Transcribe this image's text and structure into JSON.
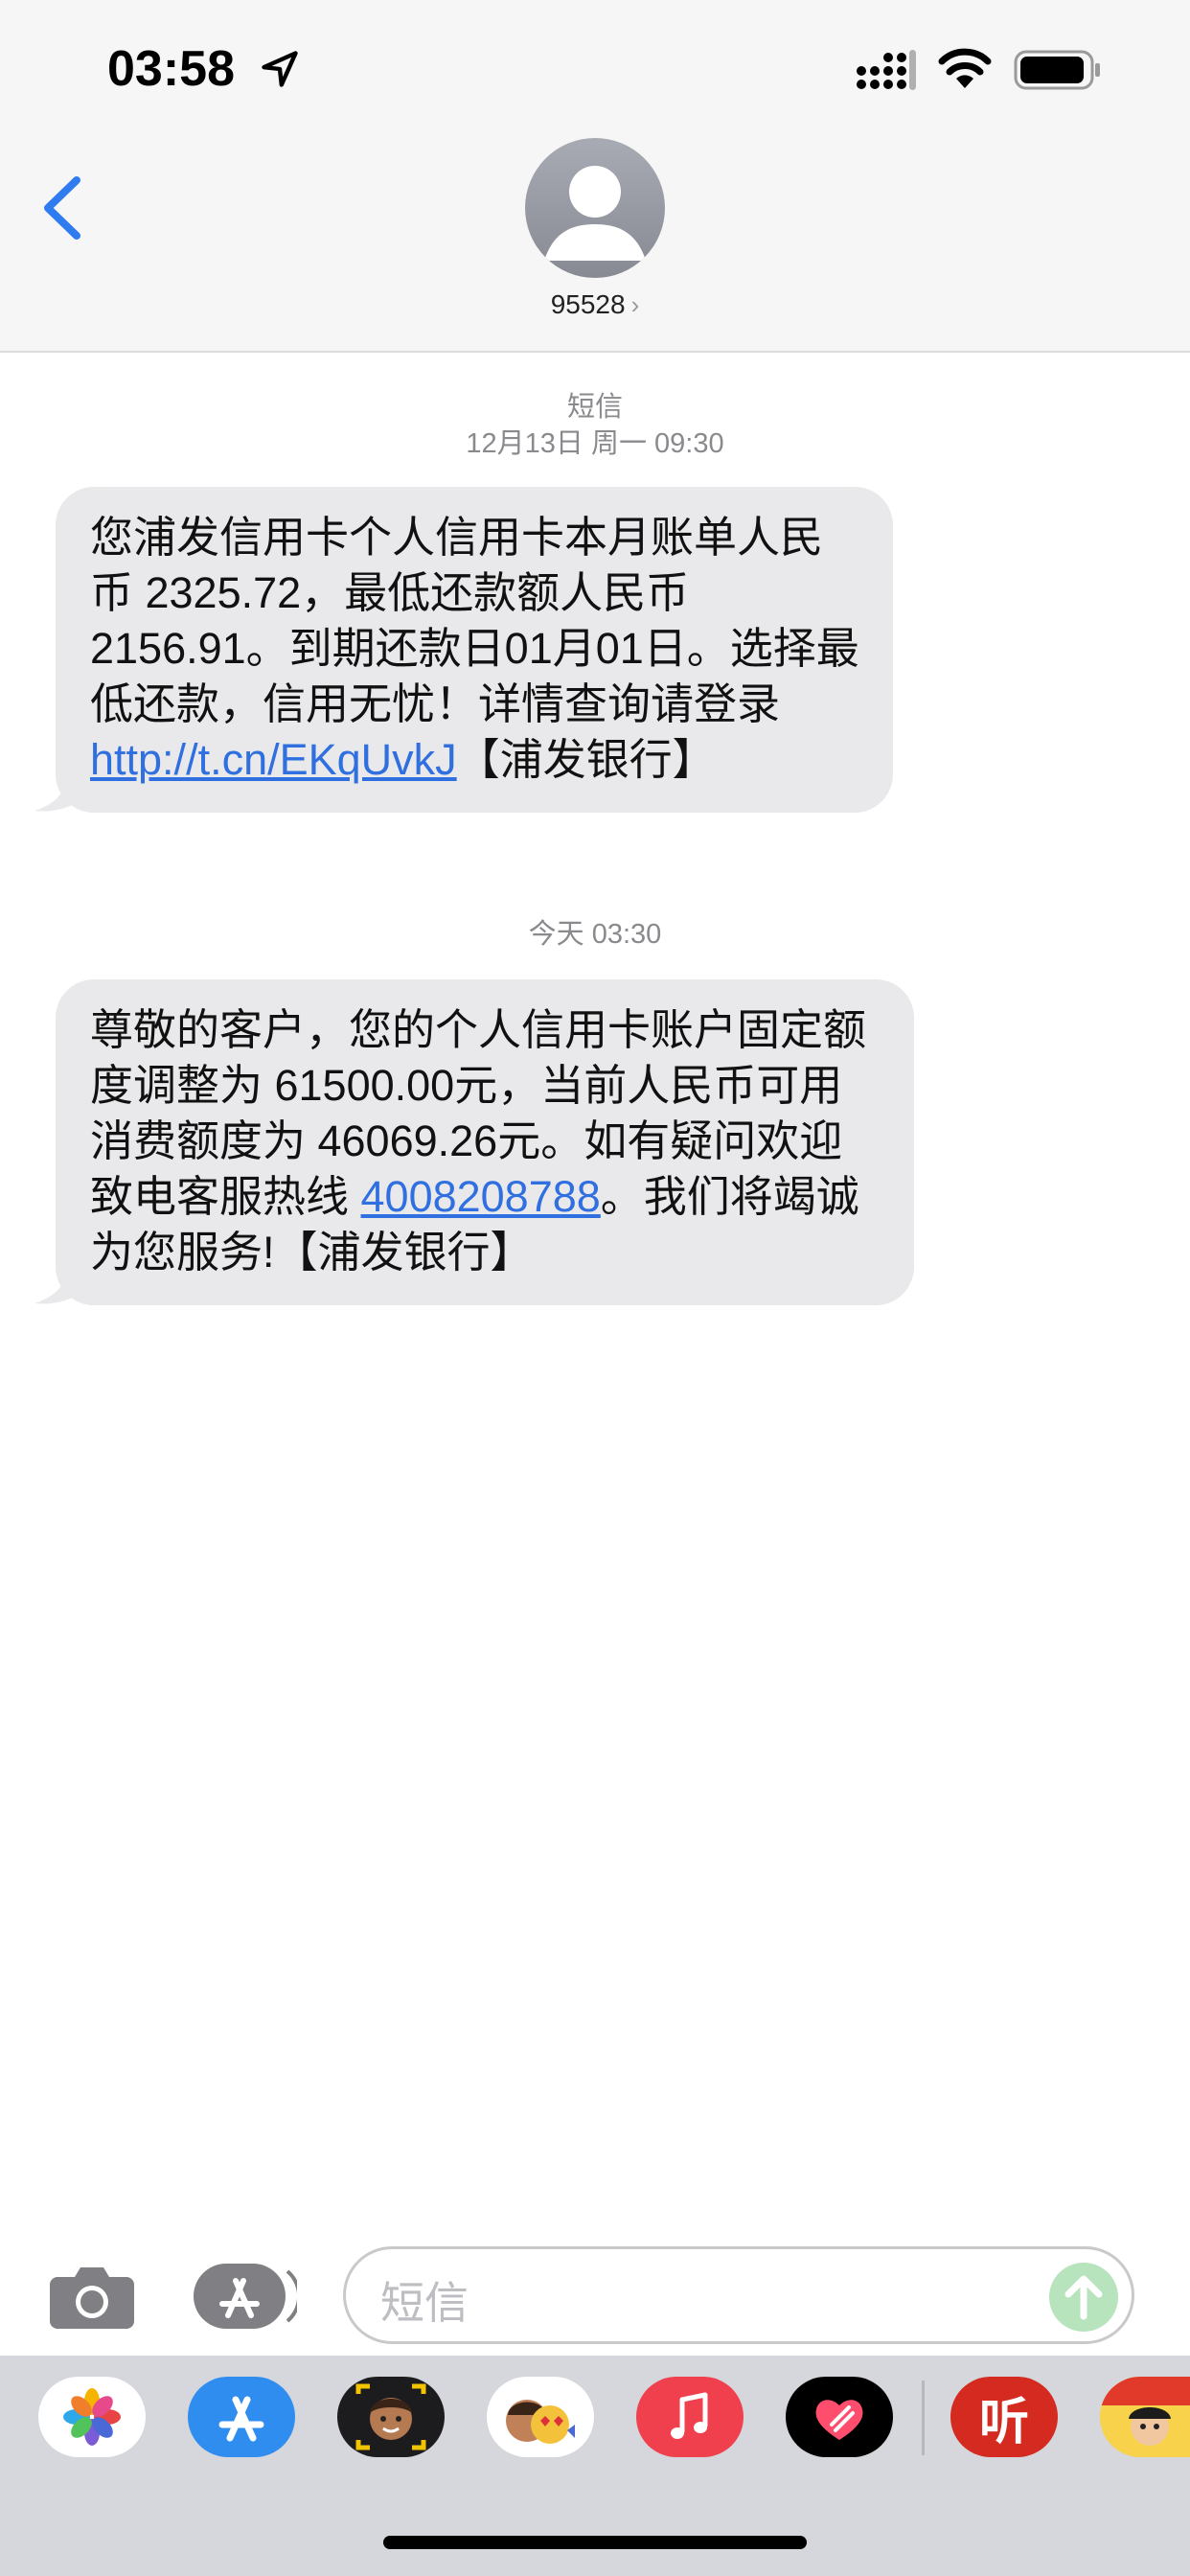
{
  "status_bar": {
    "time": "03:58"
  },
  "header": {
    "contact": "95528"
  },
  "messages": [
    {
      "timestamp_type": "短信",
      "timestamp": "12月13日 周一 09:30",
      "text_before_link": "您浦发信用卡个人信用卡本月账单人民币 2325.72，最低还款额人民币 2156.91。到期还款日01月01日。选择最低还款，信用无忧！详情查询请登录 ",
      "link": "http://t.cn/EKqUvkJ",
      "text_after_link": "【浦发银行】"
    },
    {
      "timestamp": "今天 03:30",
      "text_before_link": "尊敬的客户，您的个人信用卡账户固定额度调整为 61500.00元，当前人民币可用消费额度为 46069.26元。如有疑问欢迎致电客服热线 ",
      "link": "4008208788",
      "text_after_link": "。我们将竭诚为您服务!【浦发银行】"
    }
  ],
  "input": {
    "placeholder": "短信"
  },
  "app_drawer": {
    "apps": [
      "photos-icon",
      "app-store-icon",
      "memoji-icon",
      "animoji-icon",
      "music-icon",
      "digital-touch-icon",
      "ting-app-icon",
      "game-app-icon"
    ],
    "ting_label": "听"
  },
  "colors": {
    "link": "#2f6fe0",
    "bubble": "#e9e9eb",
    "back": "#2f7bf0",
    "send_disabled": "#b7e3bd"
  }
}
